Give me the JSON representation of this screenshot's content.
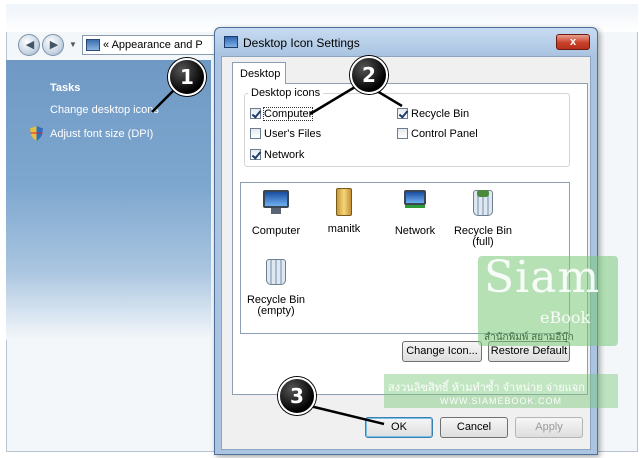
{
  "background_window": {
    "address": "Appearance and P",
    "address_prefix": "«",
    "tasks_title": "Tasks",
    "tasks": [
      {
        "label": "Change desktop icons"
      },
      {
        "label": "Adjust font size (DPI)"
      }
    ]
  },
  "dialog": {
    "title": "Desktop Icon Settings",
    "close_label": "x",
    "tab": "Desktop",
    "group_label": "Desktop icons",
    "checkboxes": [
      {
        "label": "Computer",
        "checked": true
      },
      {
        "label": "User's Files",
        "checked": false
      },
      {
        "label": "Network",
        "checked": true
      },
      {
        "label": "Recycle Bin",
        "checked": true
      },
      {
        "label": "Control Panel",
        "checked": false
      }
    ],
    "icons": [
      {
        "label": "Computer",
        "sub": "",
        "icon": "computer-icon"
      },
      {
        "label": "manitk",
        "sub": "",
        "icon": "user-folder-icon"
      },
      {
        "label": "Network",
        "sub": "",
        "icon": "network-icon"
      },
      {
        "label": "Recycle Bin",
        "sub": "(full)",
        "icon": "recycle-bin-full-icon"
      },
      {
        "label": "Recycle Bin",
        "sub": "(empty)",
        "icon": "recycle-bin-empty-icon"
      }
    ],
    "change_icon_label": "Change Icon...",
    "restore_default_label": "Restore Default",
    "ok_label": "OK",
    "cancel_label": "Cancel",
    "apply_label": "Apply"
  },
  "callouts": [
    "1",
    "2",
    "3"
  ],
  "watermark": {
    "brand": "Siam",
    "sub": "eBook",
    "thai_line": "สำนักพิมพ์ สยามอีบุ๊ก",
    "band_line1": "สงวนลิขสิทธิ์ ห้ามทำซ้ำ จำหน่าย จ่ายแจก",
    "band_line2": "WWW.SIAMEBOOK.COM"
  }
}
